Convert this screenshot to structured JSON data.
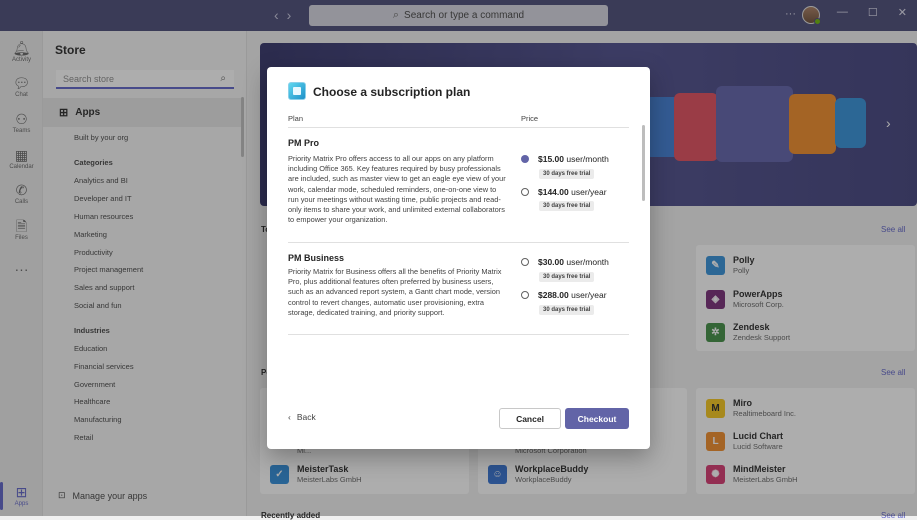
{
  "titlebar": {
    "search_placeholder": "Search or type a command",
    "more": "···",
    "minimize": "—",
    "maximize": "☐",
    "close": "✕"
  },
  "rail": [
    {
      "label": "Activity",
      "icon": "bell-icon"
    },
    {
      "label": "Chat",
      "icon": "chat-icon"
    },
    {
      "label": "Teams",
      "icon": "teams-icon"
    },
    {
      "label": "Calendar",
      "icon": "calendar-icon"
    },
    {
      "label": "Calls",
      "icon": "phone-icon"
    },
    {
      "label": "Files",
      "icon": "file-icon"
    },
    {
      "label": "Apps",
      "icon": "apps-icon"
    }
  ],
  "sidebar": {
    "title": "Store",
    "search_placeholder": "Search store",
    "apps_label": "Apps",
    "built_by_org": "Built by your org",
    "categories_title": "Categories",
    "categories": [
      "Analytics and BI",
      "Developer and IT",
      "Human resources",
      "Marketing",
      "Productivity",
      "Project management",
      "Sales and support",
      "Social and fun"
    ],
    "industries_title": "Industries",
    "industries": [
      "Education",
      "Financial services",
      "Government",
      "Healthcare",
      "Manufacturing",
      "Retail"
    ],
    "manage_apps": "Manage your apps"
  },
  "main": {
    "see_all": "See all",
    "section_top_partial": "To",
    "section_pop_partial": "Po",
    "recently_added": "Recently added",
    "apps_right_1": [
      {
        "name": "Polly",
        "company": "Polly",
        "color": "#2f8fd8"
      },
      {
        "name": "PowerApps",
        "company": "Microsoft Corp.",
        "color": "#742774"
      },
      {
        "name": "Zendesk",
        "company": "Zendesk Support",
        "color": "#3d8c40"
      }
    ],
    "apps_right_2": [
      {
        "name": "Miro",
        "company": "Realtimeboard Inc.",
        "color": "#f5c518"
      },
      {
        "name": "Lucid Chart",
        "company": "Lucid Software",
        "color": "#f08a24"
      },
      {
        "name": "MindMeister",
        "company": "MeisterLabs GmbH",
        "color": "#d6336c"
      }
    ],
    "apps_bottom": [
      {
        "name": "MeisterTask",
        "company": "MeisterLabs GmbH",
        "color": "#2b8ad8"
      },
      {
        "name": "WorkplaceBuddy",
        "company": "WorkplaceBuddy",
        "color": "#2f6fd0"
      }
    ],
    "partial_company_1": "Mi...",
    "partial_company_2": "Microsoft Corporation"
  },
  "modal": {
    "title": "Choose a subscription plan",
    "col_plan": "Plan",
    "col_price": "Price",
    "plans": [
      {
        "name": "PM Pro",
        "description": "Priority Matrix Pro offers access to all our apps on any platform including Office 365. Key features required by busy professionals are included, such as master view to get an eagle eye view of your work, calendar mode, scheduled reminders, one-on-one view to run your meetings without wasting time, public projects and read-only items to share your work, and unlimited external collaborators to empower your organization.",
        "options": [
          {
            "price": "$15.00",
            "unit": "user/month",
            "trial": "30 days free trial",
            "selected": true
          },
          {
            "price": "$144.00",
            "unit": "user/year",
            "trial": "30 days free trial",
            "selected": false
          }
        ]
      },
      {
        "name": "PM Business",
        "description": "Priority Matrix for Business offers all the benefits of Priority Matrix Pro, plus additional features often preferred by business users, such as an advanced report system, a Gantt chart mode, version control to revert changes, automatic user provisioning, extra storage, dedicated training, and priority support.",
        "options": [
          {
            "price": "$30.00",
            "unit": "user/month",
            "trial": "30 days free trial",
            "selected": false
          },
          {
            "price": "$288.00",
            "unit": "user/year",
            "trial": "30 days free trial",
            "selected": false
          }
        ]
      }
    ],
    "back_label": "Back",
    "cancel_label": "Cancel",
    "checkout_label": "Checkout"
  }
}
